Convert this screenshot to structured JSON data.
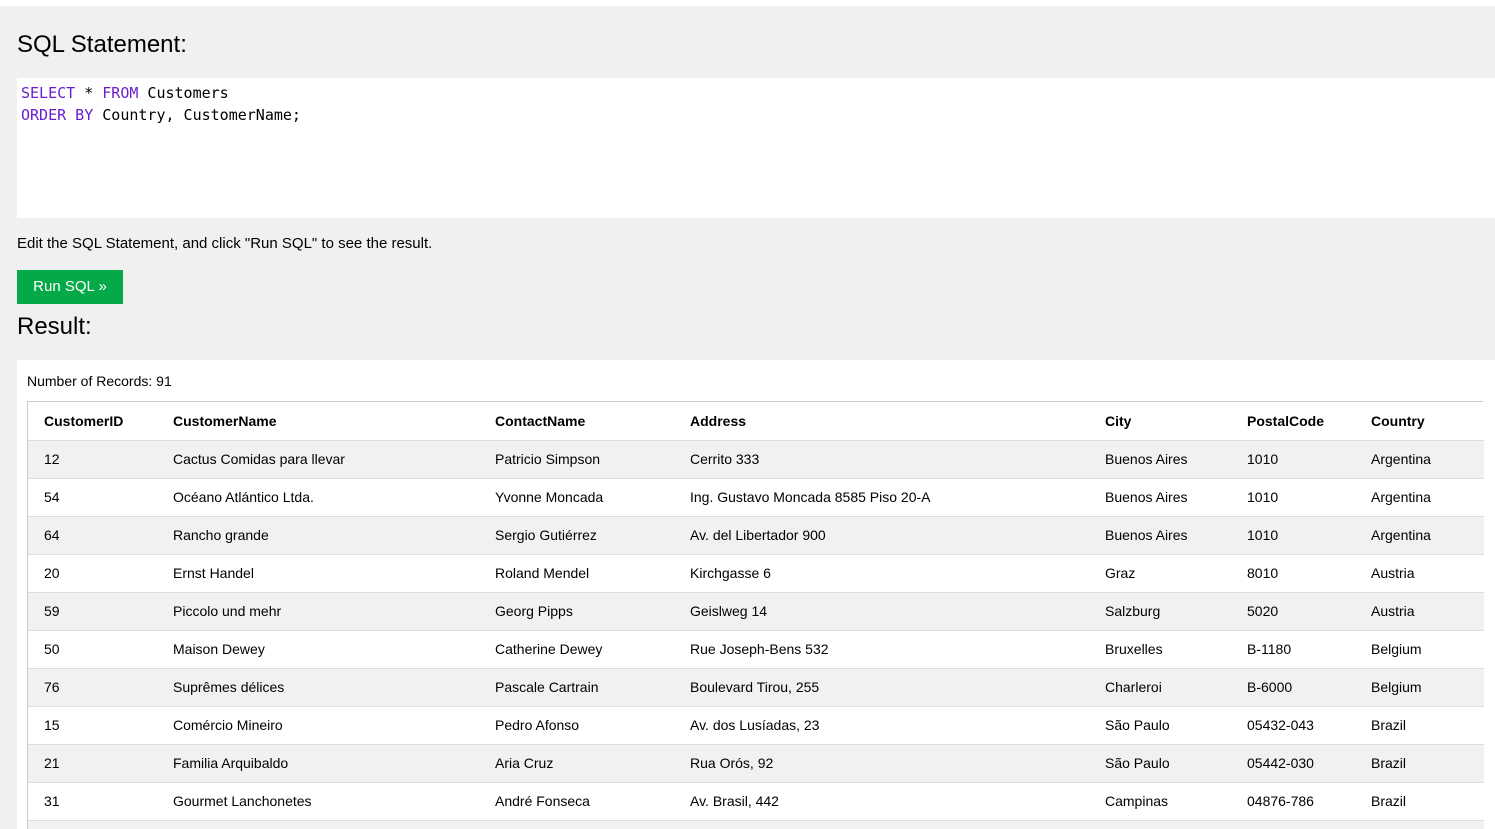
{
  "sql_heading": "SQL Statement:",
  "editor": {
    "line1": {
      "kw1": "SELECT",
      "mid1": " * ",
      "kw2": "FROM",
      "rest1": " Customers"
    },
    "line2": {
      "kw1": "ORDER BY",
      "rest1": " Country, CustomerName;"
    }
  },
  "hint": "Edit the SQL Statement, and click \"Run SQL\" to see the result.",
  "run_button": "Run SQL »",
  "result_heading": "Result:",
  "record_count": "Number of Records: 91",
  "table": {
    "columns": [
      "CustomerID",
      "CustomerName",
      "ContactName",
      "Address",
      "City",
      "PostalCode",
      "Country"
    ],
    "rows": [
      [
        "12",
        "Cactus Comidas para llevar",
        "Patricio Simpson",
        "Cerrito 333",
        "Buenos Aires",
        "1010",
        "Argentina"
      ],
      [
        "54",
        "Océano Atlántico Ltda.",
        "Yvonne Moncada",
        "Ing. Gustavo Moncada 8585 Piso 20-A",
        "Buenos Aires",
        "1010",
        "Argentina"
      ],
      [
        "64",
        "Rancho grande",
        "Sergio Gutiérrez",
        "Av. del Libertador 900",
        "Buenos Aires",
        "1010",
        "Argentina"
      ],
      [
        "20",
        "Ernst Handel",
        "Roland Mendel",
        "Kirchgasse 6",
        "Graz",
        "8010",
        "Austria"
      ],
      [
        "59",
        "Piccolo und mehr",
        "Georg Pipps",
        "Geislweg 14",
        "Salzburg",
        "5020",
        "Austria"
      ],
      [
        "50",
        "Maison Dewey",
        "Catherine Dewey",
        "Rue Joseph-Bens 532",
        "Bruxelles",
        "B-1180",
        "Belgium"
      ],
      [
        "76",
        "Suprêmes délices",
        "Pascale Cartrain",
        "Boulevard Tirou, 255",
        "Charleroi",
        "B-6000",
        "Belgium"
      ],
      [
        "15",
        "Comércio Mineiro",
        "Pedro Afonso",
        "Av. dos Lusíadas, 23",
        "São Paulo",
        "05432-043",
        "Brazil"
      ],
      [
        "21",
        "Familia Arquibaldo",
        "Aria Cruz",
        "Rua Orós, 92",
        "São Paulo",
        "05442-030",
        "Brazil"
      ],
      [
        "31",
        "Gourmet Lanchonetes",
        "André Fonseca",
        "Av. Brasil, 442",
        "Campinas",
        "04876-786",
        "Brazil"
      ],
      [
        "",
        "",
        "",
        "",
        "",
        "",
        ""
      ]
    ]
  },
  "colors": {
    "run_button_bg": "#04aa47",
    "keyword": "#6a1ecf",
    "panel_bg": "#f0f0f0"
  }
}
